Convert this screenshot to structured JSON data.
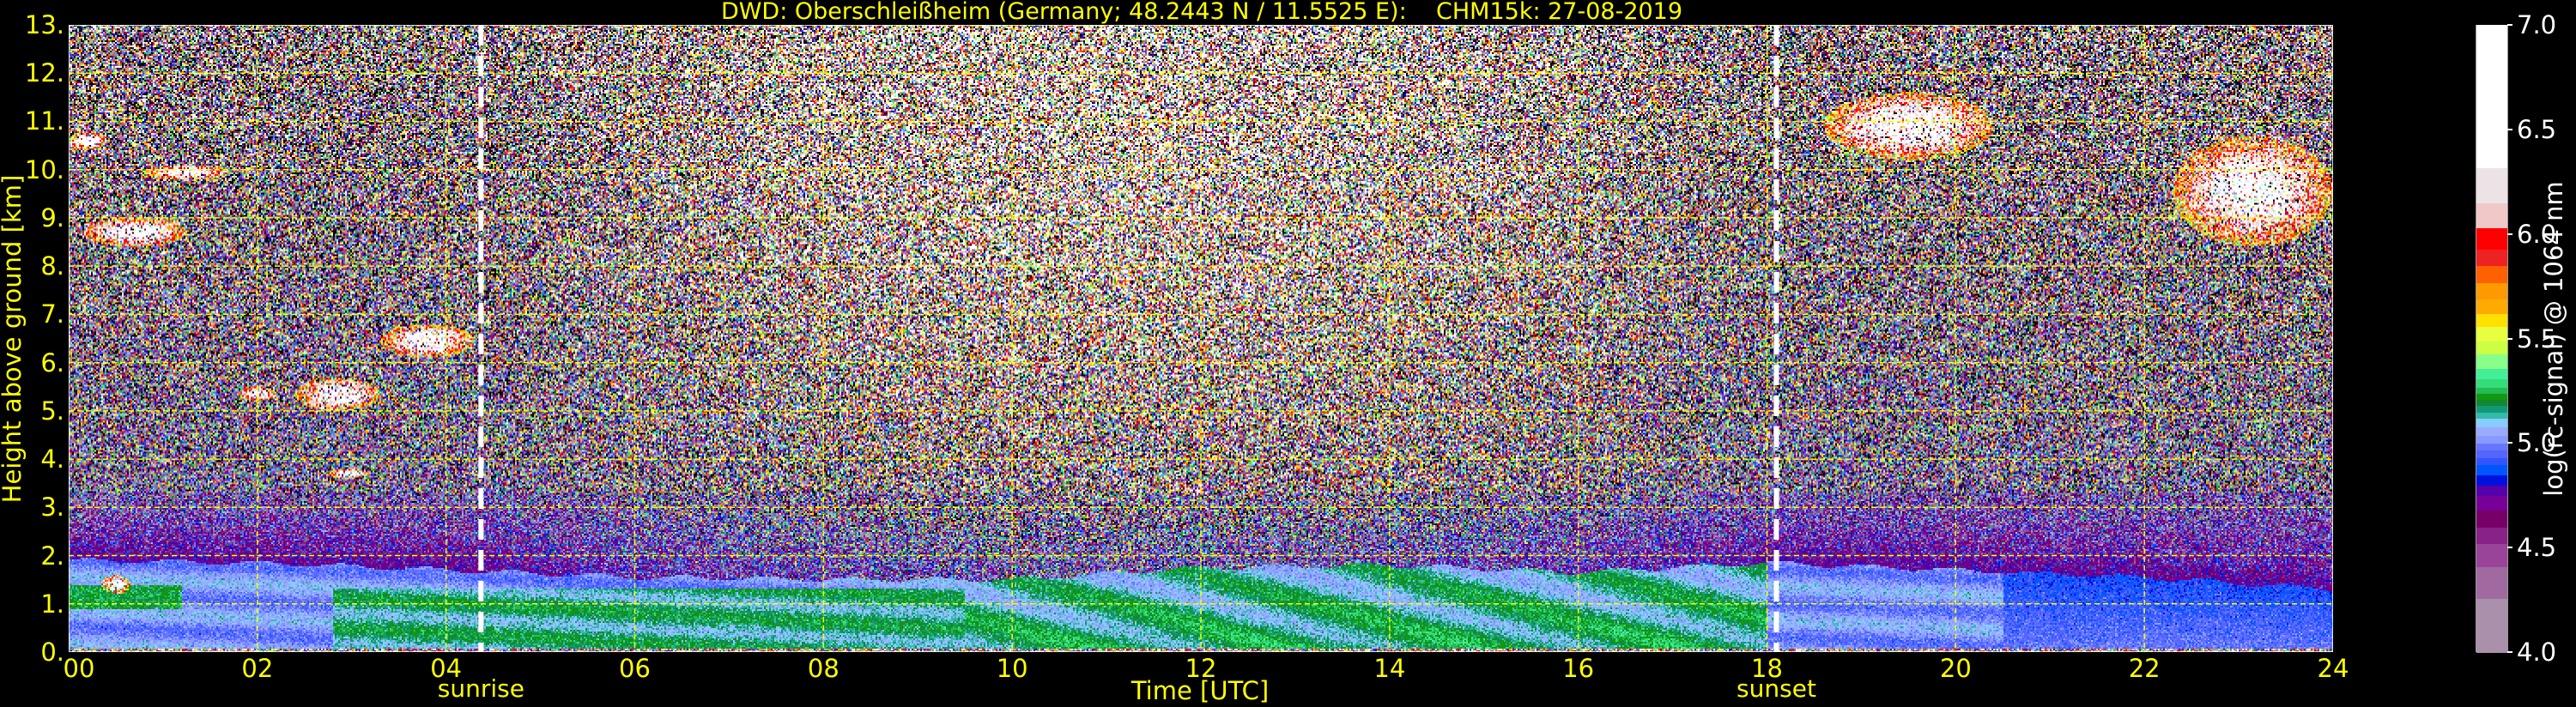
{
  "chart_data": {
    "type": "heatmap",
    "title": "DWD: Oberschleißheim (Germany; 48.2443 N / 11.5525 E):    CHM15k: 27-08-2019",
    "xlabel": "Time [UTC]",
    "ylabel": "Height above ground [km]",
    "xlim": [
      0,
      24
    ],
    "ylim": [
      0,
      13
    ],
    "x_ticks": [
      0,
      2,
      4,
      6,
      8,
      10,
      12,
      14,
      16,
      18,
      20,
      22,
      24
    ],
    "x_tick_labels": [
      "00",
      "02",
      "04",
      "06",
      "08",
      "10",
      "12",
      "14",
      "16",
      "18",
      "20",
      "22",
      "24"
    ],
    "y_ticks": [
      0,
      1,
      2,
      3,
      4,
      5,
      6,
      7,
      8,
      9,
      10,
      11,
      12,
      13
    ],
    "y_tick_labels": [
      "0.",
      "1.",
      "2.",
      "3.",
      "4.",
      "5.",
      "6.",
      "7.",
      "8.",
      "9.",
      "10.",
      "11.",
      "12.",
      "13."
    ],
    "grid": true,
    "grid_color": "#ffff00",
    "events": [
      {
        "label": "sunrise",
        "time": 4.37
      },
      {
        "label": "sunset",
        "time": 18.1
      }
    ],
    "colorbar": {
      "label": "log(rc-signal) @ 1064 nm",
      "range": [
        4.0,
        7.0
      ],
      "ticks": [
        4.0,
        4.5,
        5.0,
        5.5,
        6.0,
        6.5,
        7.0
      ],
      "tick_labels": [
        "4.0",
        "4.5",
        "5.0",
        "5.5",
        "6.0",
        "6.5",
        "7.0"
      ],
      "bands": [
        {
          "from": 4.0,
          "to": 4.26,
          "color": "#aa90aa"
        },
        {
          "from": 4.26,
          "to": 4.41,
          "color": "#a06aa0"
        },
        {
          "from": 4.41,
          "to": 4.52,
          "color": "#994499"
        },
        {
          "from": 4.52,
          "to": 4.6,
          "color": "#882288"
        },
        {
          "from": 4.6,
          "to": 4.68,
          "color": "#770066"
        },
        {
          "from": 4.68,
          "to": 4.75,
          "color": "#770099"
        },
        {
          "from": 4.75,
          "to": 4.8,
          "color": "#5500aa"
        },
        {
          "from": 4.8,
          "to": 4.85,
          "color": "#0011dd"
        },
        {
          "from": 4.85,
          "to": 4.9,
          "color": "#0055ff"
        },
        {
          "from": 4.9,
          "to": 4.93,
          "color": "#3355ff"
        },
        {
          "from": 4.93,
          "to": 4.97,
          "color": "#5566ff"
        },
        {
          "from": 4.97,
          "to": 5.0,
          "color": "#6677ff"
        },
        {
          "from": 5.0,
          "to": 5.04,
          "color": "#8899ff"
        },
        {
          "from": 5.04,
          "to": 5.08,
          "color": "#99aaff"
        },
        {
          "from": 5.08,
          "to": 5.12,
          "color": "#88ccff"
        },
        {
          "from": 5.12,
          "to": 5.15,
          "color": "#33bbaa"
        },
        {
          "from": 5.15,
          "to": 5.18,
          "color": "#119977"
        },
        {
          "from": 5.18,
          "to": 5.21,
          "color": "#118833"
        },
        {
          "from": 5.21,
          "to": 5.24,
          "color": "#119911"
        },
        {
          "from": 5.24,
          "to": 5.27,
          "color": "#22bb55"
        },
        {
          "from": 5.27,
          "to": 5.31,
          "color": "#33dd77"
        },
        {
          "from": 5.31,
          "to": 5.36,
          "color": "#44ee99"
        },
        {
          "from": 5.36,
          "to": 5.43,
          "color": "#88ff88"
        },
        {
          "from": 5.43,
          "to": 5.49,
          "color": "#ccff44"
        },
        {
          "from": 5.49,
          "to": 5.56,
          "color": "#e8ff40"
        },
        {
          "from": 5.56,
          "to": 5.62,
          "color": "#ffe000"
        },
        {
          "from": 5.62,
          "to": 5.69,
          "color": "#ffaa00"
        },
        {
          "from": 5.69,
          "to": 5.77,
          "color": "#ff9900"
        },
        {
          "from": 5.77,
          "to": 5.85,
          "color": "#ff6000"
        },
        {
          "from": 5.85,
          "to": 5.93,
          "color": "#ee2222"
        },
        {
          "from": 5.93,
          "to": 6.03,
          "color": "#ff0000"
        },
        {
          "from": 6.03,
          "to": 6.15,
          "color": "#f0c8c8"
        },
        {
          "from": 6.15,
          "to": 6.32,
          "color": "#ebe3e5"
        },
        {
          "from": 6.32,
          "to": 7.0,
          "color": "#ffffff"
        }
      ],
      "below_range_color": "#000000"
    },
    "features": [
      {
        "kind": "cloud",
        "time": [
          0.0,
          0.4
        ],
        "height_km": [
          10.4,
          10.8
        ]
      },
      {
        "kind": "cloud",
        "time": [
          0.8,
          1.7
        ],
        "height_km": [
          9.8,
          10.1
        ]
      },
      {
        "kind": "cloud",
        "time": [
          0.15,
          1.25
        ],
        "height_km": [
          8.4,
          9.0
        ]
      },
      {
        "kind": "cloud",
        "time": [
          3.3,
          4.3
        ],
        "height_km": [
          6.1,
          6.8
        ]
      },
      {
        "kind": "cloud",
        "time": [
          2.4,
          3.3
        ],
        "height_km": [
          5.0,
          5.7
        ]
      },
      {
        "kind": "cloud",
        "time": [
          1.8,
          2.2
        ],
        "height_km": [
          5.2,
          5.5
        ]
      },
      {
        "kind": "cloud",
        "time": [
          2.75,
          3.2
        ],
        "height_km": [
          3.6,
          3.8
        ]
      },
      {
        "kind": "cloud",
        "time": [
          18.6,
          20.4
        ],
        "height_km": [
          10.2,
          11.6
        ]
      },
      {
        "kind": "cloud",
        "time": [
          22.3,
          24.0
        ],
        "height_km": [
          8.4,
          10.7
        ]
      },
      {
        "kind": "aerosol",
        "time": [
          0.35,
          0.65
        ],
        "height_km": [
          1.2,
          1.6
        ]
      }
    ],
    "boundary_layer_top_km": {
      "time": [
        0,
        2,
        4,
        6,
        8,
        10,
        12,
        14,
        16,
        18,
        20,
        22,
        24
      ],
      "height": [
        1.9,
        1.85,
        1.7,
        1.55,
        1.5,
        1.5,
        1.75,
        1.8,
        1.65,
        1.85,
        1.7,
        1.55,
        1.3
      ]
    }
  }
}
